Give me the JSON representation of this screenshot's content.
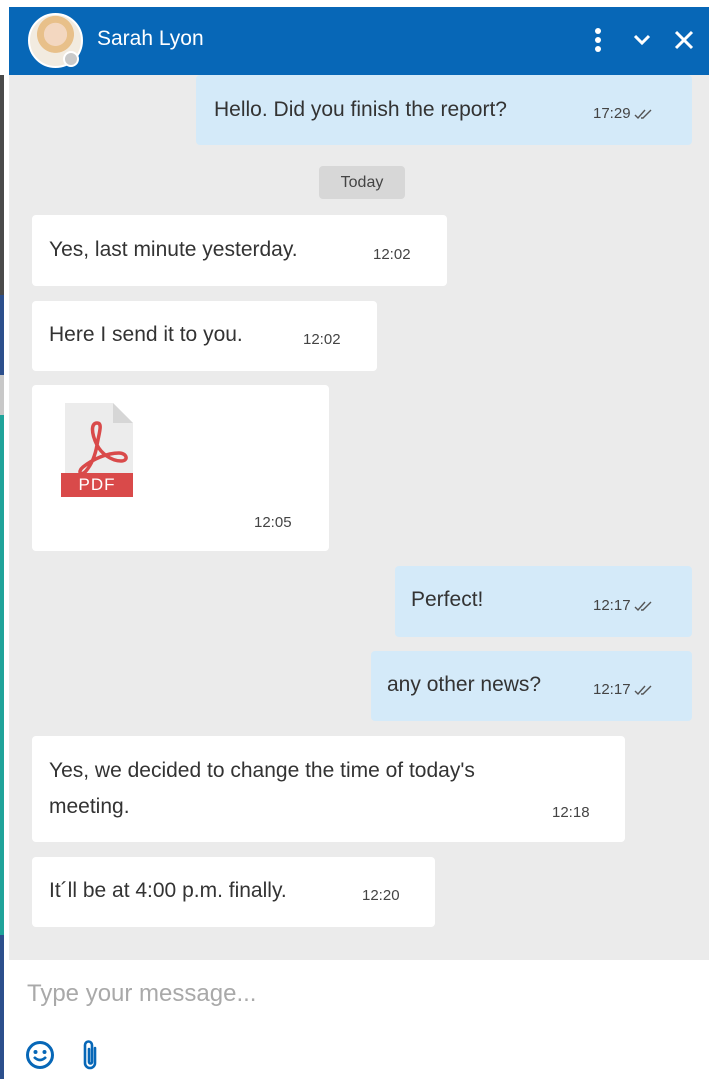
{
  "header": {
    "contact_name": "Sarah Lyon",
    "status": "offline"
  },
  "colors": {
    "header_bg": "#0767b7",
    "outgoing_bubble": "#d4eaf9",
    "incoming_bubble": "#ffffff",
    "chat_bg": "#ebebeb",
    "pdf_red": "#d94a4a"
  },
  "icons": {
    "more": "vertical-dots-icon",
    "minimize": "chevron-down-icon",
    "close": "close-icon",
    "emoji": "smiley-icon",
    "attach": "paperclip-icon",
    "delivered": "double-check-icon",
    "file": "pdf-file-icon"
  },
  "messages": [
    {
      "direction": "out",
      "text": "Hello. Did you finish the report?",
      "time": "17:29",
      "read": true
    },
    {
      "direction": "in",
      "text": "Yes, last minute yesterday.",
      "time": "12:02"
    },
    {
      "direction": "in",
      "text": "Here I send it to you.",
      "time": "12:02"
    },
    {
      "direction": "in",
      "type": "file",
      "file_label": "PDF",
      "time": "12:05"
    },
    {
      "direction": "out",
      "text": "Perfect!",
      "time": "12:17",
      "read": true
    },
    {
      "direction": "out",
      "text": "any other news?",
      "time": "12:17",
      "read": true
    },
    {
      "direction": "in",
      "text_line1": "Yes, we decided to change the time of today's",
      "text_line2": "meeting.",
      "time": "12:18"
    },
    {
      "direction": "in",
      "text": "It´ll be at 4:00 p.m. finally.",
      "time": "12:20"
    }
  ],
  "day_separator": "Today",
  "composer": {
    "placeholder": "Type your message...",
    "value": ""
  }
}
